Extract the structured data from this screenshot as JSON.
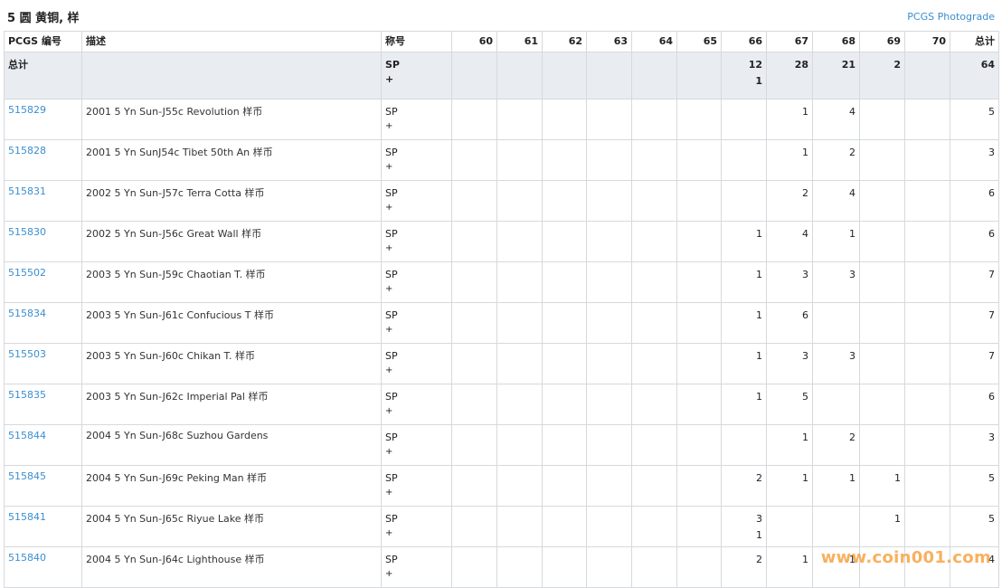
{
  "title": "5 圆 黄铜, 样",
  "photograde_link": "PCGS Photograde",
  "columns": {
    "pcgs": "PCGS 编号",
    "desc": "描述",
    "designation": "称号",
    "grades": [
      "60",
      "61",
      "62",
      "63",
      "64",
      "65",
      "66",
      "67",
      "68",
      "69",
      "70"
    ],
    "total": "总计"
  },
  "totals": {
    "label": "总计",
    "designation": "SP",
    "plus": "+",
    "grades": [
      "",
      "",
      "",
      "",
      "",
      "",
      "12\n1",
      "28",
      "21",
      "2",
      ""
    ],
    "total": "64"
  },
  "rows": [
    {
      "pcgs": "515829",
      "desc": "2001 5 Yn Sun-J55c Revolution 样币",
      "designation": "SP",
      "plus": "+",
      "grades": [
        "",
        "",
        "",
        "",
        "",
        "",
        "",
        "1",
        "4",
        "",
        ""
      ],
      "total": "5"
    },
    {
      "pcgs": "515828",
      "desc": "2001 5 Yn SunJ54c Tibet 50th An 样币",
      "designation": "SP",
      "plus": "+",
      "grades": [
        "",
        "",
        "",
        "",
        "",
        "",
        "",
        "1",
        "2",
        "",
        ""
      ],
      "total": "3"
    },
    {
      "pcgs": "515831",
      "desc": "2002 5 Yn Sun-J57c Terra Cotta 样币",
      "designation": "SP",
      "plus": "+",
      "grades": [
        "",
        "",
        "",
        "",
        "",
        "",
        "",
        "2",
        "4",
        "",
        ""
      ],
      "total": "6"
    },
    {
      "pcgs": "515830",
      "desc": "2002 5 Yn Sun-J56c Great Wall 样币",
      "designation": "SP",
      "plus": "+",
      "grades": [
        "",
        "",
        "",
        "",
        "",
        "",
        "1",
        "4",
        "1",
        "",
        ""
      ],
      "total": "6"
    },
    {
      "pcgs": "515502",
      "desc": "2003 5 Yn Sun-J59c Chaotian T. 样币",
      "designation": "SP",
      "plus": "+",
      "grades": [
        "",
        "",
        "",
        "",
        "",
        "",
        "1",
        "3",
        "3",
        "",
        ""
      ],
      "total": "7"
    },
    {
      "pcgs": "515834",
      "desc": "2003 5 Yn Sun-J61c Confucious T 样币",
      "designation": "SP",
      "plus": "+",
      "grades": [
        "",
        "",
        "",
        "",
        "",
        "",
        "1",
        "6",
        "",
        "",
        ""
      ],
      "total": "7"
    },
    {
      "pcgs": "515503",
      "desc": "2003 5 Yn Sun-J60c Chikan T. 样币",
      "designation": "SP",
      "plus": "+",
      "grades": [
        "",
        "",
        "",
        "",
        "",
        "",
        "1",
        "3",
        "3",
        "",
        ""
      ],
      "total": "7"
    },
    {
      "pcgs": "515835",
      "desc": "2003 5 Yn Sun-J62c Imperial Pal 样币",
      "designation": "SP",
      "plus": "+",
      "grades": [
        "",
        "",
        "",
        "",
        "",
        "",
        "1",
        "5",
        "",
        "",
        ""
      ],
      "total": "6"
    },
    {
      "pcgs": "515844",
      "desc": "2004 5 Yn Sun-J68c Suzhou Gardens",
      "designation": "SP",
      "plus": "+",
      "grades": [
        "",
        "",
        "",
        "",
        "",
        "",
        "",
        "1",
        "2",
        "",
        ""
      ],
      "total": "3"
    },
    {
      "pcgs": "515845",
      "desc": "2004 5 Yn Sun-J69c Peking Man 样币",
      "designation": "SP",
      "plus": "+",
      "grades": [
        "",
        "",
        "",
        "",
        "",
        "",
        "2",
        "1",
        "1",
        "1",
        ""
      ],
      "total": "5"
    },
    {
      "pcgs": "515841",
      "desc": "2004 5 Yn Sun-J65c Riyue Lake 样币",
      "designation": "SP",
      "plus": "+",
      "grades": [
        "",
        "",
        "",
        "",
        "",
        "",
        "3\n1",
        "",
        "",
        "1",
        ""
      ],
      "total": "5"
    },
    {
      "pcgs": "515840",
      "desc": "2004 5 Yn Sun-J64c Lighthouse 样币",
      "designation": "SP",
      "plus": "+",
      "grades": [
        "",
        "",
        "",
        "",
        "",
        "",
        "2",
        "1",
        "1",
        "",
        ""
      ],
      "total": "4"
    }
  ],
  "watermark": "www.coin001.com",
  "colors": {
    "link": "#3a8fd0",
    "total_row_bg": "#e9edf1",
    "border": "#d6d9dd",
    "watermark": "#f59628"
  }
}
